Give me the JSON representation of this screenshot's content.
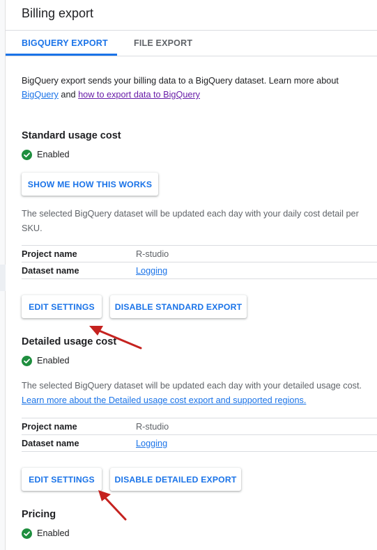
{
  "header": {
    "title": "Billing export"
  },
  "tabs": [
    {
      "label": "BIGQUERY EXPORT",
      "active": true
    },
    {
      "label": "FILE EXPORT",
      "active": false
    }
  ],
  "intro": {
    "text": "BigQuery export sends your billing data to a BigQuery dataset. Learn more about",
    "link1": "BigQuery",
    "and": "and",
    "link2": "how to export data to BigQuery"
  },
  "standard": {
    "heading": "Standard usage cost",
    "status": "Enabled",
    "show_me_button": "SHOW ME HOW THIS WORKS",
    "description": "The selected BigQuery dataset will be updated each day with your daily cost detail per SKU.",
    "rows": [
      {
        "label": "Project name",
        "value": "R-studio"
      },
      {
        "label": "Dataset name",
        "value": "Logging"
      }
    ],
    "edit_button": "EDIT SETTINGS",
    "disable_button": "DISABLE STANDARD EXPORT"
  },
  "detailed": {
    "heading": "Detailed usage cost",
    "status": "Enabled",
    "description": "The selected BigQuery dataset will be updated each day with your detailed usage cost.",
    "learn_more_link": "Learn more about the Detailed usage cost export and supported regions.",
    "rows": [
      {
        "label": "Project name",
        "value": "R-studio"
      },
      {
        "label": "Dataset name",
        "value": "Logging"
      }
    ],
    "edit_button": "EDIT SETTINGS",
    "disable_button": "DISABLE DETAILED EXPORT"
  },
  "pricing": {
    "heading": "Pricing",
    "status": "Enabled"
  },
  "colors": {
    "accent": "#1a73e8",
    "visited_link": "#681da8",
    "enabled_green": "#1e8e3e",
    "annotation_arrow": "#c5221f"
  }
}
